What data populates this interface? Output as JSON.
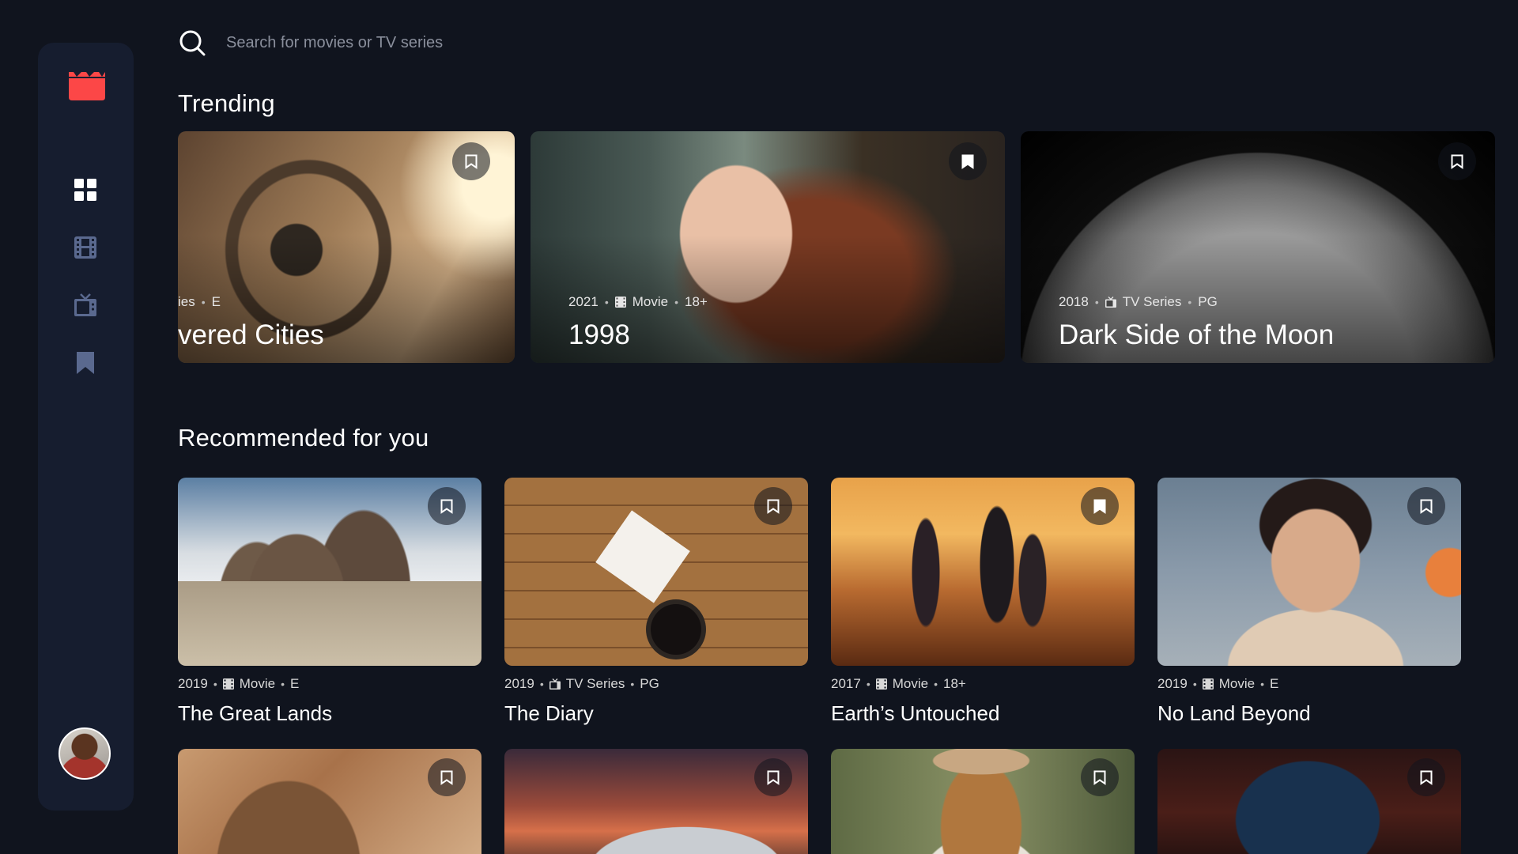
{
  "search": {
    "placeholder": "Search for movies or TV series"
  },
  "nav": {
    "logo": "film-clapper-logo",
    "items": [
      {
        "name": "home",
        "icon": "grid-icon",
        "active": true
      },
      {
        "name": "movies",
        "icon": "film-icon",
        "active": false
      },
      {
        "name": "tv-series",
        "icon": "tv-icon",
        "active": false
      },
      {
        "name": "bookmarks",
        "icon": "bookmark-icon",
        "active": false
      }
    ]
  },
  "colors": {
    "background": "#10141e",
    "sidebar": "#161d2f",
    "accent": "#fc4747",
    "nav_inactive": "#5a698f",
    "text": "#ffffff"
  },
  "trending": {
    "title": "Trending",
    "items": [
      {
        "year": "ies",
        "category": "",
        "rating": "E",
        "title": "vered Cities",
        "bookmarked": false
      },
      {
        "year": "2021",
        "category": "Movie",
        "rating": "18+",
        "title": "1998",
        "bookmarked": true
      },
      {
        "year": "2018",
        "category": "TV Series",
        "rating": "PG",
        "title": "Dark Side of the Moon",
        "bookmarked": false
      }
    ]
  },
  "recommended": {
    "title": "Recommended for you",
    "items": [
      {
        "year": "2019",
        "category": "Movie",
        "rating": "E",
        "title": "The Great Lands",
        "bookmarked": false
      },
      {
        "year": "2019",
        "category": "TV Series",
        "rating": "PG",
        "title": "The Diary",
        "bookmarked": false
      },
      {
        "year": "2017",
        "category": "Movie",
        "rating": "18+",
        "title": "Earth’s Untouched",
        "bookmarked": true
      },
      {
        "year": "2019",
        "category": "Movie",
        "rating": "E",
        "title": "No Land Beyond",
        "bookmarked": false
      }
    ]
  }
}
